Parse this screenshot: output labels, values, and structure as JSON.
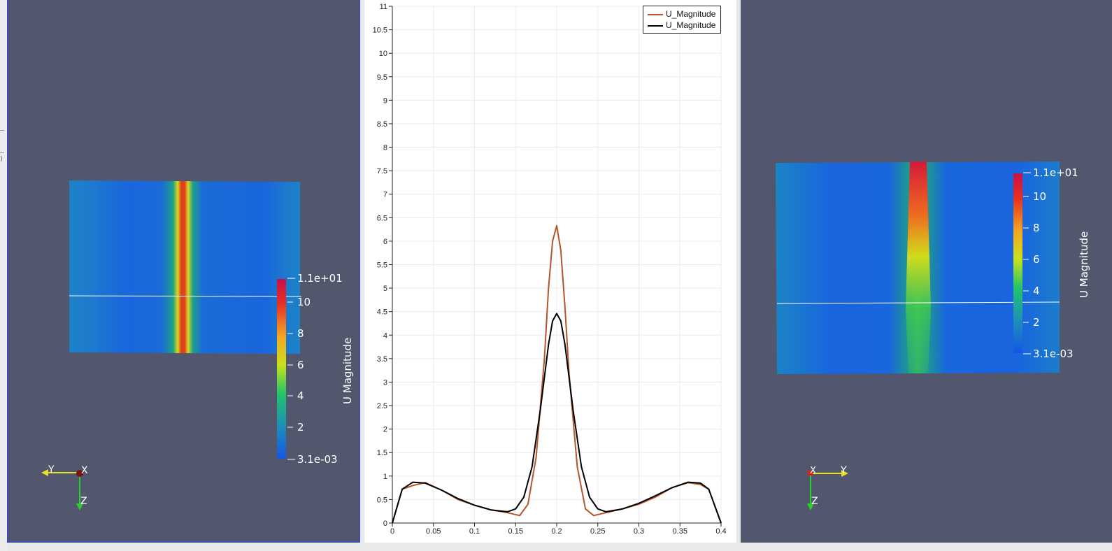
{
  "left_panel_marks": {
    "glyph": ")"
  },
  "views": {
    "left": {
      "colorbar": {
        "title": "U Magnitude",
        "max_label": "1.1e+01",
        "min_label": "3.1e-03",
        "ticks": [
          "10",
          "8",
          "6",
          "4",
          "2"
        ]
      },
      "axes": {
        "horizontal": "Y",
        "out": "X",
        "down": "Z"
      }
    },
    "right": {
      "colorbar": {
        "title": "U Magnitude",
        "max_label": "1.1e+01",
        "min_label": "3.1e-03",
        "ticks": [
          "10",
          "8",
          "6",
          "4",
          "2"
        ]
      },
      "axes": {
        "origin": "X",
        "horizontal": "Y",
        "down": "Z"
      }
    }
  },
  "colors": {
    "background": "#52576e",
    "series_1": "#b5552a",
    "series_2": "#000000",
    "colormap": [
      "#1556e6",
      "#1e8fb8",
      "#20c46a",
      "#c9e21a",
      "#f5a623",
      "#e83020",
      "#c8104a"
    ]
  },
  "chart_data": {
    "type": "line",
    "title": "",
    "xlabel": "",
    "ylabel": "",
    "xlim": [
      0,
      0.4
    ],
    "ylim": [
      0,
      11
    ],
    "grid": true,
    "legend": "top-right",
    "x_ticks": [
      0,
      0.05,
      0.1,
      0.15,
      0.2,
      0.25,
      0.3,
      0.35,
      0.4
    ],
    "y_ticks": [
      0,
      0.5,
      1,
      1.5,
      2,
      2.5,
      3,
      3.5,
      4,
      4.5,
      5,
      5.5,
      6,
      6.5,
      7,
      7.5,
      8,
      8.5,
      9,
      9.5,
      10,
      10.5,
      11
    ],
    "series": [
      {
        "name": "U_Magnitude",
        "x": [
          0,
          0.012,
          0.025,
          0.04,
          0.06,
          0.08,
          0.1,
          0.12,
          0.14,
          0.155,
          0.165,
          0.175,
          0.185,
          0.19,
          0.195,
          0.2,
          0.205,
          0.21,
          0.215,
          0.225,
          0.235,
          0.245,
          0.26,
          0.28,
          0.3,
          0.32,
          0.34,
          0.36,
          0.375,
          0.385,
          0.4
        ],
        "y": [
          0,
          0.72,
          0.8,
          0.86,
          0.7,
          0.5,
          0.38,
          0.28,
          0.22,
          0.16,
          0.4,
          1.4,
          3.5,
          5.0,
          6.0,
          6.33,
          5.8,
          4.6,
          3.2,
          1.2,
          0.3,
          0.16,
          0.22,
          0.3,
          0.4,
          0.55,
          0.75,
          0.86,
          0.82,
          0.72,
          0
        ]
      },
      {
        "name": "U_Magnitude",
        "x": [
          0,
          0.012,
          0.025,
          0.04,
          0.06,
          0.08,
          0.1,
          0.12,
          0.14,
          0.15,
          0.16,
          0.17,
          0.18,
          0.19,
          0.195,
          0.2,
          0.205,
          0.21,
          0.22,
          0.23,
          0.24,
          0.25,
          0.26,
          0.28,
          0.3,
          0.32,
          0.34,
          0.36,
          0.375,
          0.385,
          0.4
        ],
        "y": [
          0,
          0.72,
          0.87,
          0.85,
          0.7,
          0.52,
          0.38,
          0.28,
          0.24,
          0.3,
          0.55,
          1.2,
          2.4,
          3.8,
          4.3,
          4.46,
          4.3,
          3.8,
          2.4,
          1.2,
          0.55,
          0.3,
          0.24,
          0.3,
          0.42,
          0.58,
          0.75,
          0.87,
          0.85,
          0.72,
          0
        ]
      }
    ]
  }
}
